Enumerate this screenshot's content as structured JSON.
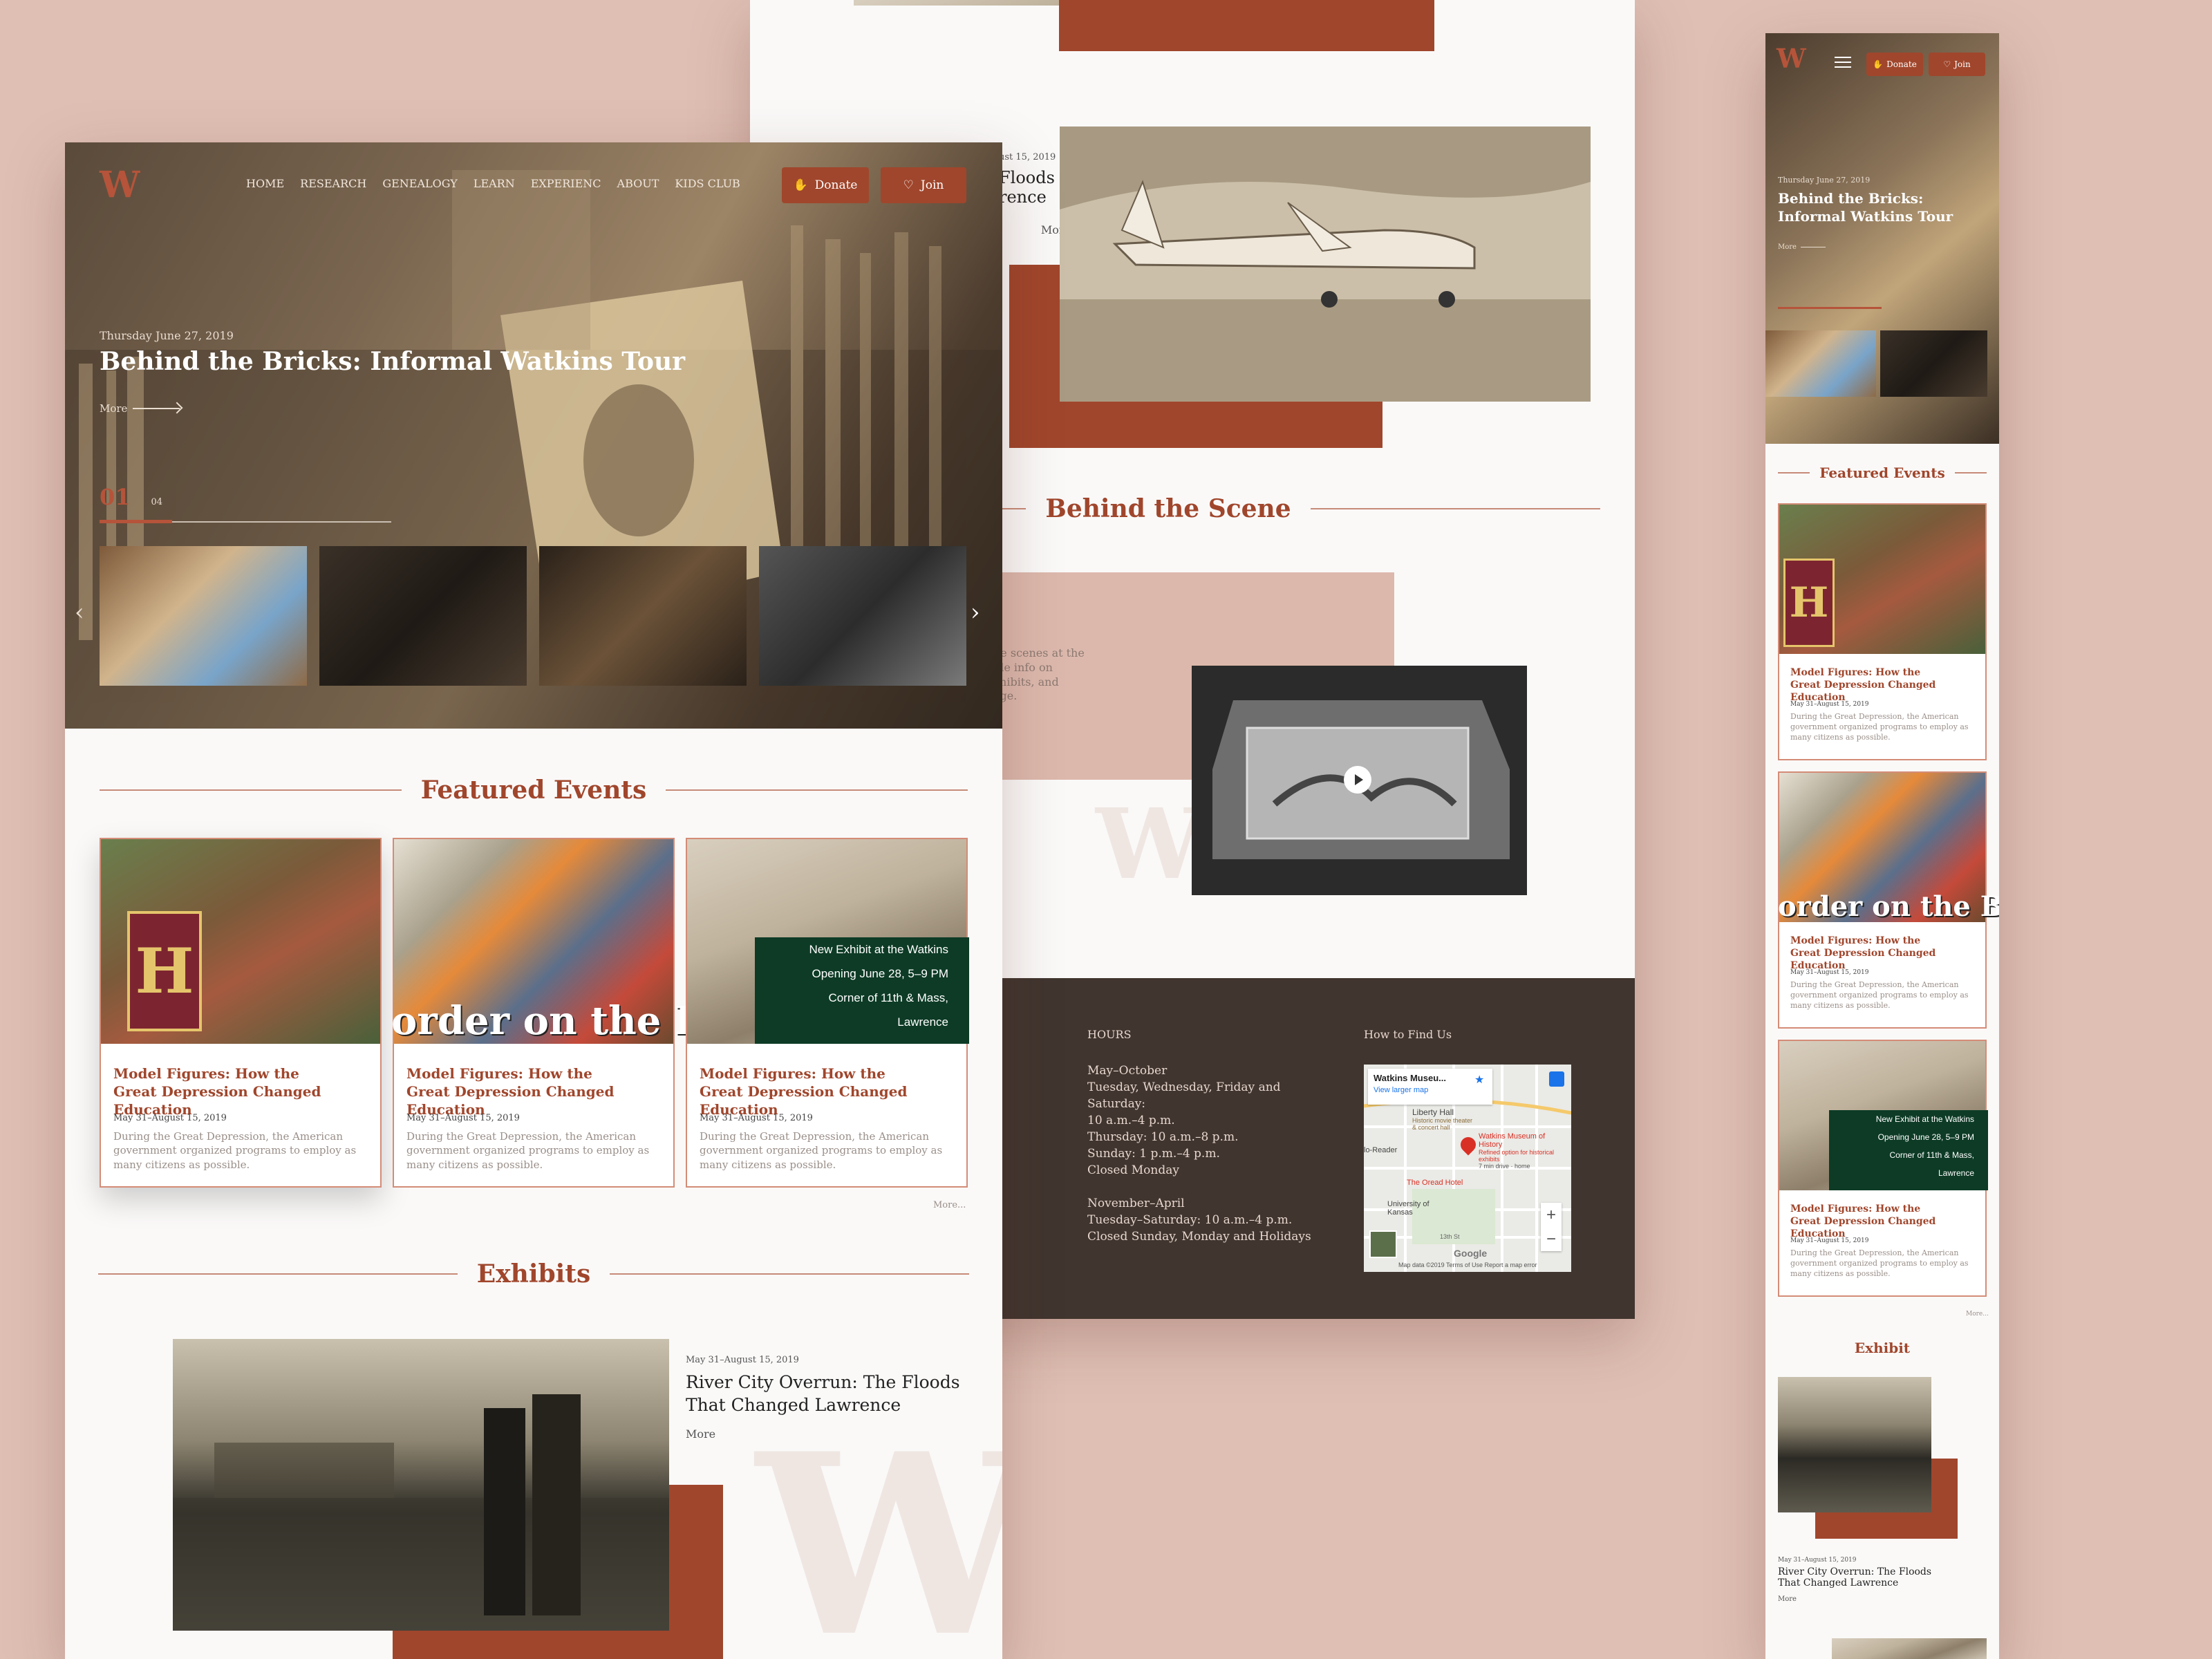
{
  "desktop": {
    "nav": [
      "HOME",
      "RESEARCH",
      "GENEALOGY",
      "LEARN",
      "EXPERIENC",
      "ABOUT",
      "KIDS CLUB"
    ],
    "donate_label": "Donate",
    "join_label": "Join",
    "hero": {
      "date": "Thursday June 27, 2019",
      "title": "Behind the Bricks: Informal Watkins Tour",
      "more": "More",
      "slide_current": "01",
      "slide_total": "04"
    },
    "featured_title": "Featured Events",
    "events": [
      {
        "title_l1": "Model Figures: How the",
        "title_l2": "Great Depression Changed Education",
        "date": "May 31–August 15, 2019",
        "desc": "During the Great Depression, the American government organized programs to employ as many citizens as possible."
      },
      {
        "title_l1": "Model Figures: How the",
        "title_l2": "Great Depression Changed Education",
        "date": "May 31–August 15, 2019",
        "desc": "During the Great Depression, the American government organized programs to employ as many citizens as possible."
      },
      {
        "title_l1": "Model Figures: How the",
        "title_l2": "Great Depression Changed Education",
        "date": "May 31–August 15, 2019",
        "desc": "During the Great Depression, the American government organized programs to employ as many citizens as possible."
      }
    ],
    "banner_text": "order on the Bor",
    "exhibit_sign": [
      "New Exhibit at the Watkins",
      "Opening June 28, 5–9 PM",
      "Corner of 11th & Mass,",
      "Lawrence"
    ],
    "more_link": "More...",
    "exhibits_title": "Exhibits",
    "exhibit": {
      "date": "May 31–August 15, 2019",
      "title_l1": "River City Overrun: The Floods",
      "title_l2": "That Changed Lawrence",
      "more": "More"
    }
  },
  "middle": {
    "exhibit_partial": {
      "date": "ust 15, 2019",
      "t1": "Floods",
      "t2": "rence",
      "more": "More"
    },
    "behind_title": "Behind the Scene",
    "behind_text": [
      "ne scenes at the",
      "ide info on",
      "xhibits, and",
      "age."
    ],
    "footer": {
      "hours_label": "HOURS",
      "hours_lines": [
        "May–October",
        "Tuesday, Wednesday, Friday and",
        "Saturday:",
        "10 a.m.–4 p.m.",
        "Thursday: 10 a.m.–8 p.m.",
        "Sunday: 1 p.m.–4 p.m.",
        "Closed Monday",
        "",
        "November–April",
        "Tuesday–Saturday: 10 a.m.–4 p.m.",
        "Closed Sunday, Monday and Holidays"
      ],
      "find_label": "How to Find Us",
      "map": {
        "place": "Watkins Museu...",
        "larger": "View larger map",
        "liberty": "Liberty Hall",
        "liberty_sub": "Historic movie theater & concert hall",
        "museum": "Watkins Museum of History",
        "museum_sub": "Refined option for historical exhibits",
        "drive": "7 min drive · home",
        "reader": "lo-Reader",
        "oread": "The Oread Hotel",
        "university": "University of Kansas",
        "street": "13th St",
        "google": "Google",
        "footer": "Map data ©2019   Terms of Use   Report a map error"
      }
    }
  },
  "mobile": {
    "donate_label": "Donate",
    "join_label": "Join",
    "hero_date": "Thursday June 27, 2019",
    "hero_title_l1": "Behind the Bricks:",
    "hero_title_l2": "Informal Watkins Tour",
    "hero_more": "More",
    "featured_title": "Featured Events",
    "events": [
      {
        "title_l1": "Model Figures: How the",
        "title_l2": "Great Depression Changed Education",
        "date": "May 31–August 15, 2019",
        "desc": "During the Great Depression, the American government organized programs to employ as many citizens as possible."
      },
      {
        "title_l1": "Model Figures: How the",
        "title_l2": "Great Depression Changed Education",
        "date": "May 31–August 15, 2019",
        "desc": "During the Great Depression, the American government organized programs to employ as many citizens as possible."
      },
      {
        "title_l1": "Model Figures: How the",
        "title_l2": "Great Depression Changed Education",
        "date": "May 31–August 15, 2019",
        "desc": "During the Great Depression, the American government organized programs to employ as many citizens as possible."
      }
    ],
    "banner_text": "order on the Bor",
    "more_link": "More...",
    "exhibit_title": "Exhibit",
    "exhibit": {
      "date": "May 31–August 15, 2019",
      "title_l1": "River City Overrun: The Floods",
      "title_l2": "That Changed Lawrence",
      "more": "More"
    }
  },
  "colors": {
    "accent": "#a0462c",
    "background": "#dfbfb4",
    "footer": "#40352f"
  }
}
